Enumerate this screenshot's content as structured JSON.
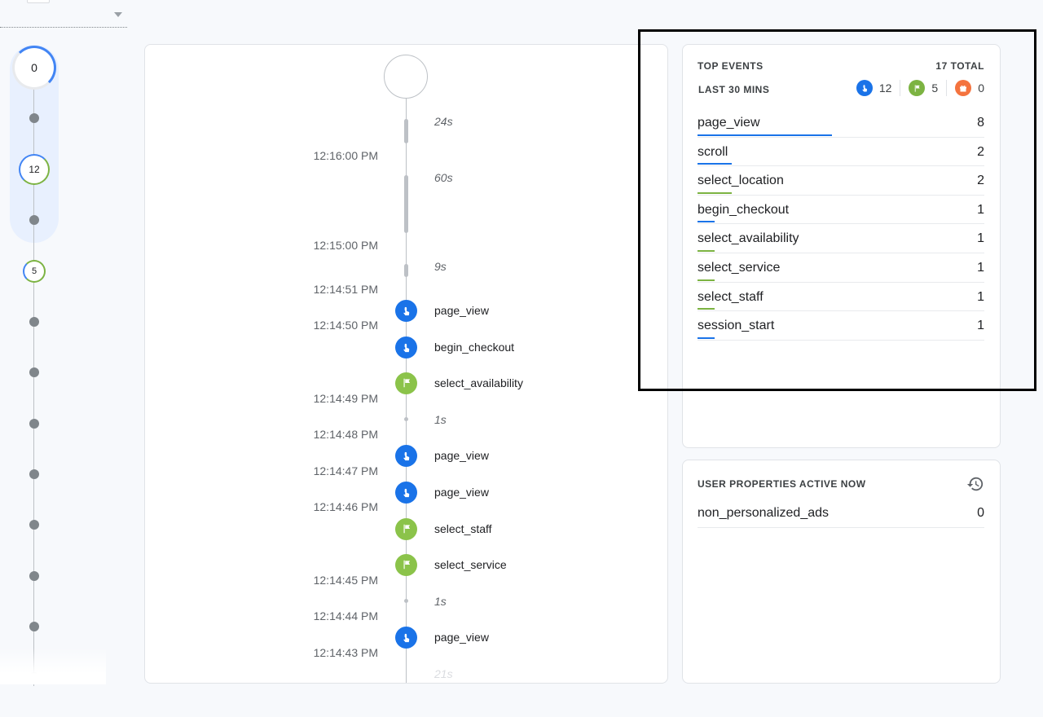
{
  "colors": {
    "accent_blue": "#1a73e8",
    "accent_green": "#7cb342",
    "accent_orange": "#f4733e"
  },
  "rail": {
    "bubbles": [
      "0",
      "12",
      "5"
    ]
  },
  "timeline": {
    "times": [
      "12:16:00 PM",
      "12:15:00 PM",
      "12:14:51 PM",
      "12:14:50 PM",
      "12:14:49 PM",
      "12:14:48 PM",
      "12:14:47 PM",
      "12:14:46 PM",
      "12:14:45 PM",
      "12:14:44 PM",
      "12:14:43 PM"
    ],
    "durations": [
      "24s",
      "60s",
      "9s",
      "1s",
      "1s",
      "21s"
    ],
    "events": [
      {
        "name": "page_view",
        "icon": "touch-icon",
        "color": "blue"
      },
      {
        "name": "begin_checkout",
        "icon": "touch-icon",
        "color": "blue"
      },
      {
        "name": "select_availability",
        "icon": "flag-icon",
        "color": "green"
      },
      {
        "name": "page_view",
        "icon": "touch-icon",
        "color": "blue"
      },
      {
        "name": "page_view",
        "icon": "touch-icon",
        "color": "blue"
      },
      {
        "name": "select_staff",
        "icon": "flag-icon",
        "color": "green"
      },
      {
        "name": "select_service",
        "icon": "flag-icon",
        "color": "green"
      },
      {
        "name": "page_view",
        "icon": "touch-icon",
        "color": "blue"
      }
    ]
  },
  "top_events": {
    "title": "TOP EVENTS",
    "total": "17 TOTAL",
    "period": "LAST 30 MINS",
    "counts": {
      "touch": "12",
      "flag": "5",
      "gift": "0"
    },
    "rows": [
      {
        "name": "page_view",
        "count": "8",
        "share": 0.47,
        "color": "blue"
      },
      {
        "name": "scroll",
        "count": "2",
        "share": 0.12,
        "color": "blue"
      },
      {
        "name": "select_location",
        "count": "2",
        "share": 0.12,
        "color": "green"
      },
      {
        "name": "begin_checkout",
        "count": "1",
        "share": 0.06,
        "color": "blue"
      },
      {
        "name": "select_availability",
        "count": "1",
        "share": 0.06,
        "color": "green"
      },
      {
        "name": "select_service",
        "count": "1",
        "share": 0.06,
        "color": "green"
      },
      {
        "name": "select_staff",
        "count": "1",
        "share": 0.06,
        "color": "green"
      },
      {
        "name": "session_start",
        "count": "1",
        "share": 0.06,
        "color": "blue"
      }
    ]
  },
  "user_properties": {
    "title": "USER PROPERTIES ACTIVE NOW",
    "rows": [
      {
        "name": "non_personalized_ads",
        "value": "0"
      }
    ]
  }
}
